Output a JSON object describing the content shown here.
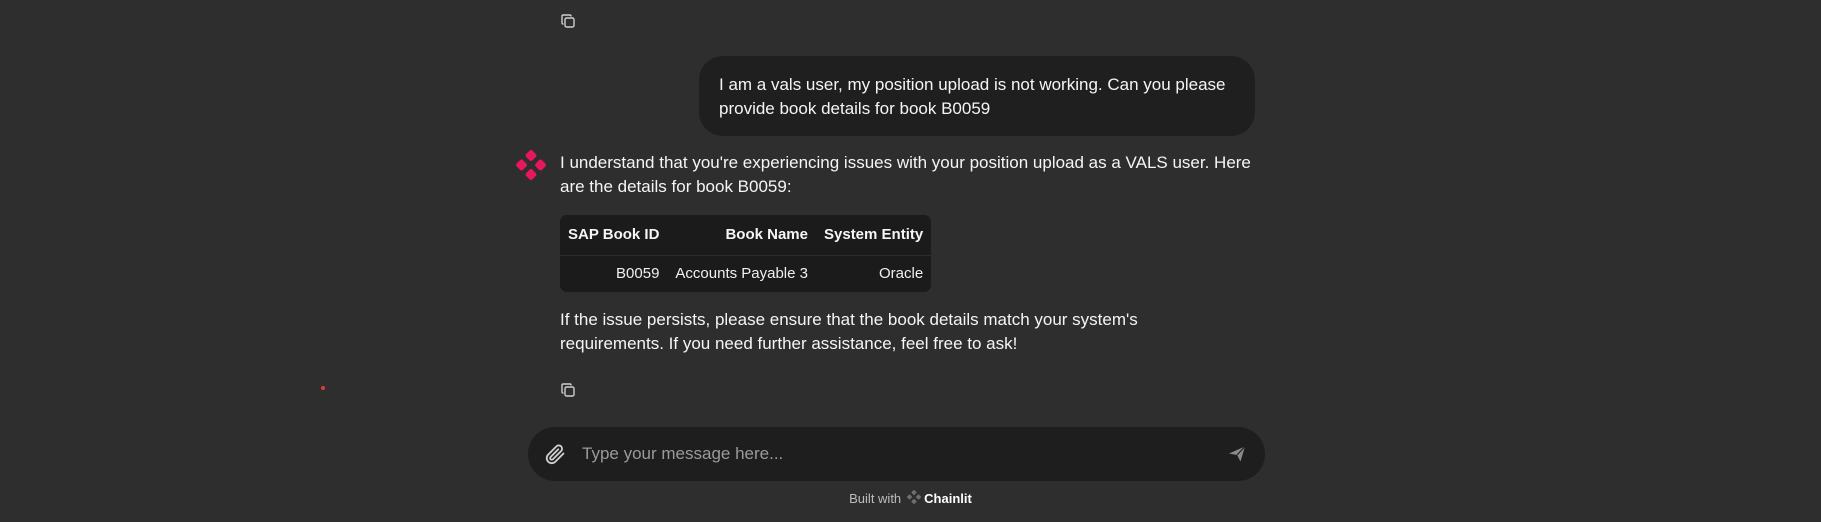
{
  "conversation": {
    "user_message": "I am a vals user, my position upload is not working.   Can you please provide book details for book B0059",
    "assistant": {
      "intro": "I understand that you're experiencing issues with your position upload as a VALS user. Here are the details for book B0059:",
      "table": {
        "headers": [
          "SAP Book ID",
          "Book Name",
          "System Entity"
        ],
        "rows": [
          [
            "B0059",
            "Accounts Payable 3",
            "Oracle"
          ]
        ]
      },
      "follow_up": "If the issue persists, please ensure that the book details match your system's requirements. If you need further assistance, feel free to ask!"
    }
  },
  "composer": {
    "placeholder": "Type your message here..."
  },
  "footer": {
    "built_with": "Built with",
    "brand": "Chainlit"
  },
  "icons": {
    "copy": "copy-icon",
    "avatar": "assistant-logo-icon",
    "attach": "paperclip-icon",
    "send": "send-icon"
  },
  "colors": {
    "background": "#2e2e2e",
    "bubble": "#1f1f1f",
    "accent": "#e8175d",
    "table_bg": "#1b1b1b"
  }
}
